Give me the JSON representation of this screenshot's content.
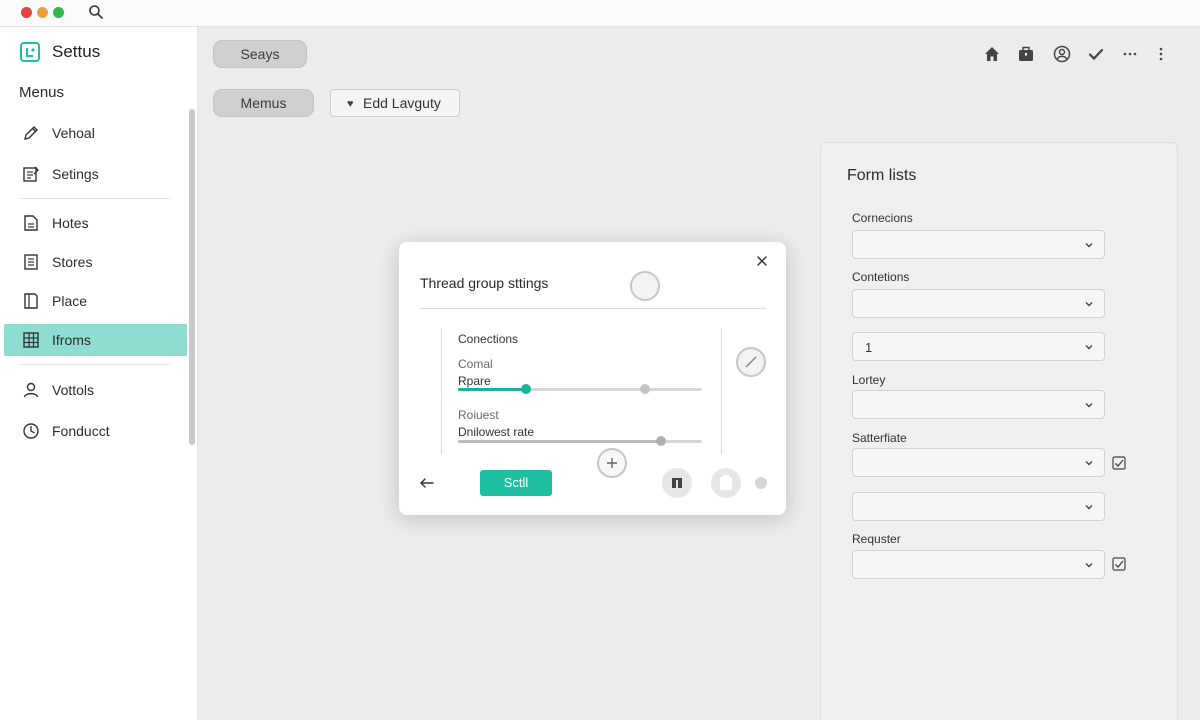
{
  "window": {
    "traffic_lights": [
      "red",
      "yellow",
      "green"
    ],
    "search_icon": "search-icon"
  },
  "sidebar": {
    "app_title": "Settus",
    "section_label": "Menus",
    "items": [
      {
        "label": "Vehoal",
        "icon": "pencil-icon"
      },
      {
        "label": "Setings",
        "icon": "settings-document-icon"
      },
      {
        "label": "Hotes",
        "icon": "document-icon"
      },
      {
        "label": "Stores",
        "icon": "list-document-icon"
      },
      {
        "label": "Place",
        "icon": "book-icon"
      },
      {
        "label": "Ifroms",
        "icon": "grid-icon",
        "active": true
      },
      {
        "label": "Vottols",
        "icon": "user-icon"
      },
      {
        "label": "Fonducct",
        "icon": "clock-icon"
      }
    ]
  },
  "toolbar": {
    "pill_button": "Seays",
    "menus_button": "Memus",
    "edit_button": "Edd Lavguty",
    "icons": [
      "home-icon",
      "briefcase-icon",
      "user-circle-icon",
      "check-icon",
      "more-horizontal-icon",
      "more-vertical-icon"
    ]
  },
  "panel": {
    "title": "Form lists",
    "fields": [
      {
        "label": "Cornecions",
        "value": ""
      },
      {
        "label": "Contetions",
        "value": ""
      },
      {
        "label": "",
        "value": "1"
      },
      {
        "label": "Lortey",
        "value": ""
      },
      {
        "label": "Satterfiate",
        "value": "",
        "checkbox": true
      },
      {
        "label": "",
        "value": ""
      },
      {
        "label": "Requster",
        "value": "",
        "checkbox": true
      }
    ]
  },
  "dialog": {
    "title": "Thread group sttings",
    "section": "Conections",
    "slider1_caption": "Comal",
    "slider1_label": "Rpare",
    "slider1_value": 0.28,
    "slider2_caption": "Roiuest",
    "slider2_label": "Dnilowest rate",
    "slider2_value": 0.83,
    "submit": "Sctll"
  },
  "colors": {
    "accent": "#1fbfa2",
    "active_nav": "#8fdcd0"
  }
}
